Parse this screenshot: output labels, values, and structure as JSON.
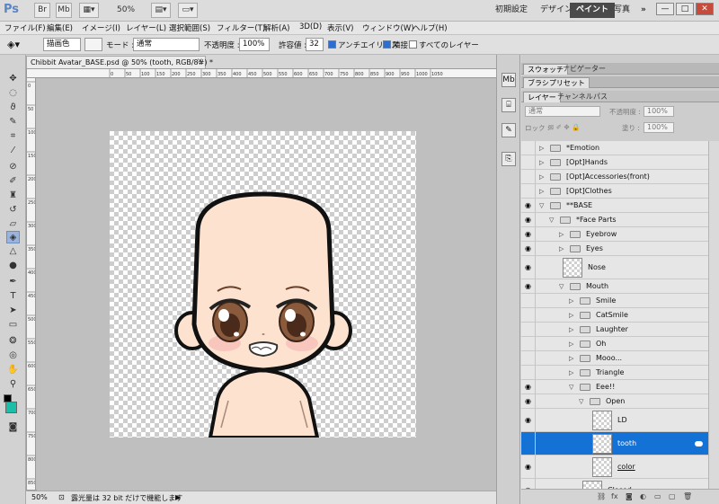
{
  "app": {
    "logo": "Ps",
    "bridge_label": "Br",
    "minibridge_label": "Mb",
    "zoom_value": "50%",
    "workspaces": [
      "初期設定",
      "デザイン",
      "ペイント",
      "写真"
    ],
    "workspace_active": "ペイント",
    "more_label": "»",
    "win_controls": [
      "—",
      "□",
      "✕"
    ]
  },
  "menu": [
    "ファイル(F)",
    "編集(E)",
    "イメージ(I)",
    "レイヤー(L)",
    "選択範囲(S)",
    "フィルター(T)",
    "解析(A)",
    "3D(D)",
    "表示(V)",
    "ウィンドウ(W)",
    "ヘルプ(H)"
  ],
  "options": {
    "fill_source": "描画色",
    "mode_label": "モード :",
    "mode_value": "通常",
    "opacity_label": "不透明度 :",
    "opacity_value": "100%",
    "tolerance_label": "許容値 :",
    "tolerance_value": "32",
    "antialias": "アンチエイリアス",
    "contiguous": "隣接",
    "all_layers": "すべてのレイヤー"
  },
  "document": {
    "tab_title": "Chibbit Avatar_BASE.psd @ 50% (tooth, RGB/8#) *",
    "close": "×",
    "ruler_h": [
      "0",
      "50",
      "100",
      "150",
      "200",
      "250",
      "300",
      "350",
      "400",
      "450",
      "500",
      "550",
      "600",
      "650",
      "700",
      "750",
      "800",
      "850",
      "900",
      "950",
      "1000",
      "1050"
    ],
    "ruler_v": [
      "0",
      "50",
      "100",
      "150",
      "200",
      "250",
      "300",
      "350",
      "400",
      "450",
      "500",
      "550",
      "600",
      "650",
      "700",
      "750",
      "800",
      "850"
    ]
  },
  "status": {
    "zoom": "50%",
    "message": "露光量は 32 bit だけで機能します"
  },
  "panels": {
    "top_tabs": [
      "スウォッチ",
      "ナビゲーター"
    ],
    "brush_preset": "ブラシプリセット",
    "layer_tabs": [
      "レイヤー",
      "チャンネル",
      "パス"
    ],
    "blend_mode": "通常",
    "opacity_label": "不透明度 :",
    "opacity_value": "100%",
    "lock_label": "ロック :",
    "fill_label": "塗り :",
    "fill_value": "100%"
  },
  "layers": [
    {
      "name": "*Emotion",
      "type": "group",
      "depth": 0,
      "expanded": false,
      "visible": false
    },
    {
      "name": "[Opt]Hands",
      "type": "group",
      "depth": 0,
      "expanded": false,
      "visible": false
    },
    {
      "name": "[Opt]Accessories(front)",
      "type": "group",
      "depth": 0,
      "expanded": false,
      "visible": false
    },
    {
      "name": "[Opt]Clothes",
      "type": "group",
      "depth": 0,
      "expanded": false,
      "visible": false
    },
    {
      "name": "**BASE",
      "type": "group",
      "depth": 0,
      "expanded": true,
      "visible": true
    },
    {
      "name": "*Face Parts",
      "type": "group",
      "depth": 1,
      "expanded": true,
      "visible": true
    },
    {
      "name": "Eyebrow",
      "type": "group",
      "depth": 2,
      "expanded": false,
      "visible": true
    },
    {
      "name": "Eyes",
      "type": "group",
      "depth": 2,
      "expanded": false,
      "visible": true
    },
    {
      "name": "Nose",
      "type": "layer",
      "depth": 2,
      "visible": true
    },
    {
      "name": "Mouth",
      "type": "group",
      "depth": 2,
      "expanded": true,
      "visible": true
    },
    {
      "name": "Smile",
      "type": "group",
      "depth": 3,
      "expanded": false,
      "visible": false
    },
    {
      "name": "CatSmile",
      "type": "group",
      "depth": 3,
      "expanded": false,
      "visible": false
    },
    {
      "name": "Laughter",
      "type": "group",
      "depth": 3,
      "expanded": false,
      "visible": false
    },
    {
      "name": "Oh",
      "type": "group",
      "depth": 3,
      "expanded": false,
      "visible": false
    },
    {
      "name": "Mooo...",
      "type": "group",
      "depth": 3,
      "expanded": false,
      "visible": false
    },
    {
      "name": "Triangle",
      "type": "group",
      "depth": 3,
      "expanded": false,
      "visible": false
    },
    {
      "name": "Eee!!",
      "type": "group",
      "depth": 3,
      "expanded": true,
      "visible": true
    },
    {
      "name": "Open",
      "type": "group",
      "depth": 4,
      "expanded": true,
      "visible": true
    },
    {
      "name": "LD",
      "type": "layer",
      "depth": 5,
      "visible": true
    },
    {
      "name": "tooth",
      "type": "layer",
      "depth": 5,
      "visible": false,
      "selected": true,
      "linked": true
    },
    {
      "name": "color",
      "type": "layer",
      "depth": 5,
      "visible": true,
      "underline": true
    },
    {
      "name": "Closed",
      "type": "layer",
      "depth": 4,
      "visible": true
    }
  ],
  "colors": {
    "foreground": "#000000",
    "background": "#1bbfa8",
    "skin": "#fde3cf",
    "iris": "#8a5a3c",
    "selection": "#1471d6"
  },
  "icons": {
    "eye": "eye-icon",
    "folder": "folder-icon",
    "expand": "triangle-right-icon",
    "collapse": "triangle-down-icon"
  }
}
